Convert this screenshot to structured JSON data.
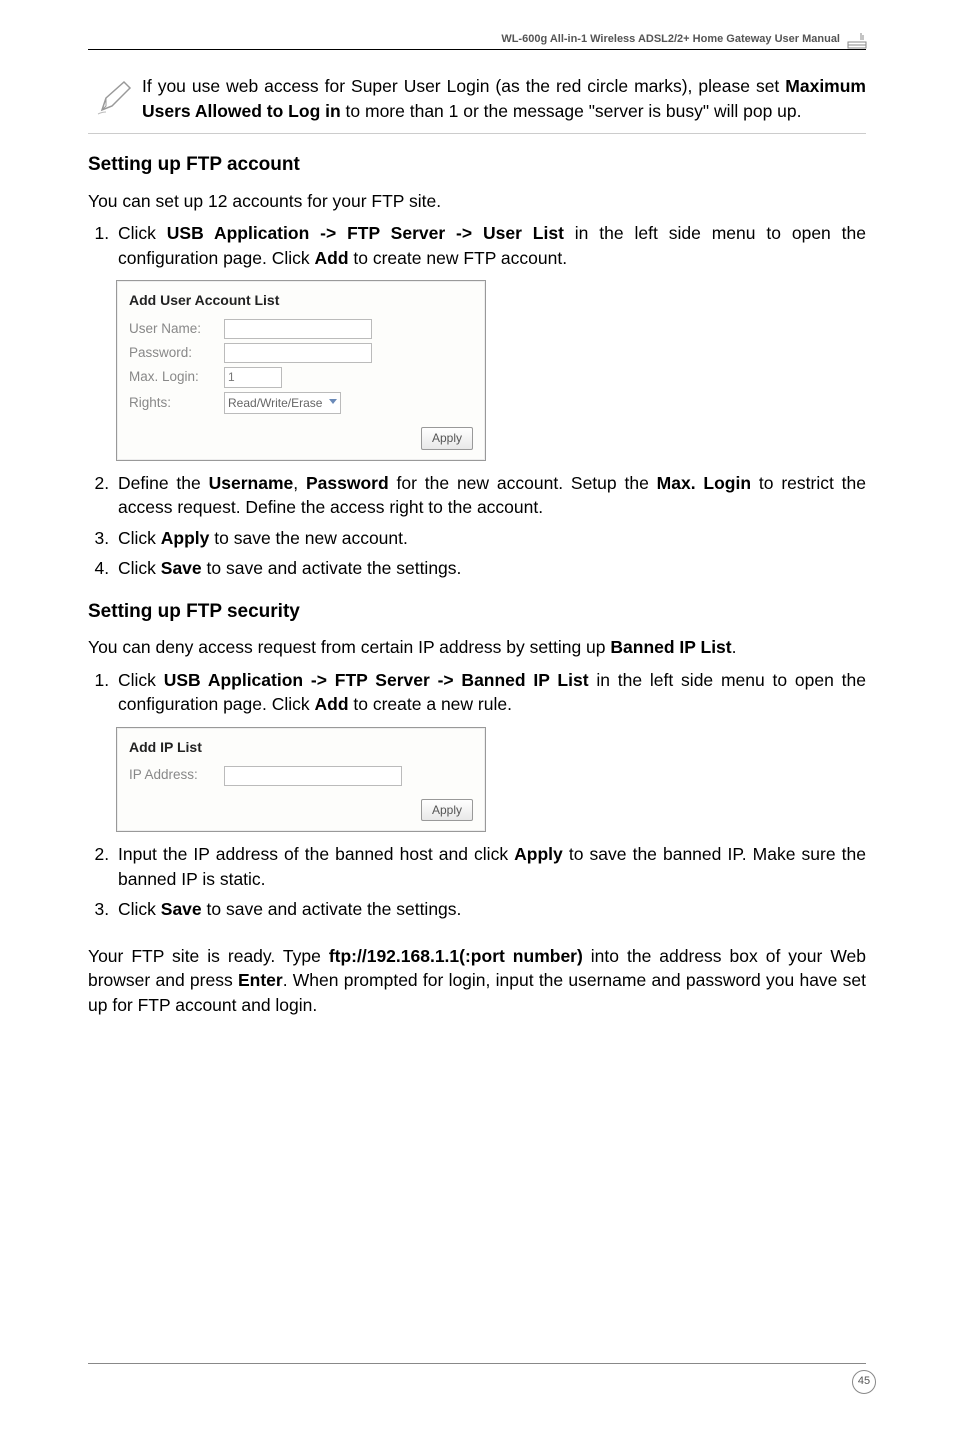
{
  "header": {
    "title": "WL-600g All-in-1 Wireless ADSL2/2+ Home Gateway User Manual"
  },
  "note": {
    "text_a": "If you use web access for Super User Login (as the red circle marks), please set ",
    "text_b": "Maximum Users Allowed to Log in",
    "text_c": " to more than 1 or the message \"server is busy\" will pop up."
  },
  "section1": {
    "heading": "Setting up FTP account",
    "intro": "You can set up 12 accounts for your FTP site.",
    "step1_a": "Click ",
    "step1_b": "USB Application -> FTP Server -> User List",
    "step1_c": " in the left side menu to open the configuration page. Click ",
    "step1_d": "Add",
    "step1_e": " to create new FTP account.",
    "panel": {
      "title": "Add User Account List",
      "user_label": "User Name:",
      "pass_label": "Password:",
      "max_label": "Max. Login:",
      "max_value": "1",
      "rights_label": "Rights:",
      "rights_value": "Read/Write/Erase",
      "apply": "Apply"
    },
    "step2_a": "Define the ",
    "step2_b": "Username",
    "step2_c": ", ",
    "step2_d": "Password",
    "step2_e": " for the new account. Setup the ",
    "step2_f": "Max. Login",
    "step2_g": " to restrict the access request. Define the access right to the account.",
    "step3_a": "Click ",
    "step3_b": "Apply",
    "step3_c": " to save the new account.",
    "step4_a": "Click ",
    "step4_b": "Save",
    "step4_c": " to save and activate the settings."
  },
  "section2": {
    "heading": "Setting up FTP security",
    "intro_a": "You can deny access request from certain IP address by setting up ",
    "intro_b": "Banned IP List",
    "intro_c": ".",
    "step1_a": "Click ",
    "step1_b": "USB Application -> FTP Server -> Banned IP List",
    "step1_c": " in the left side menu to open the configuration page. Click ",
    "step1_d": "Add",
    "step1_e": " to create a new rule.",
    "panel": {
      "title": "Add IP List",
      "ip_label": "IP Address:",
      "apply": "Apply"
    },
    "step2_a": "Input the IP address of the banned host and click ",
    "step2_b": "Apply",
    "step2_c": " to save the banned IP. Make sure the banned IP is static.",
    "step3_a": "Click ",
    "step3_b": "Save",
    "step3_c": " to save and activate the settings."
  },
  "footer_para": {
    "a": "Your FTP site is ready. Type ",
    "b": "ftp://192.168.1.1(:port number)",
    "c": " into the address box of your Web browser and press ",
    "d": "Enter",
    "e": ". When prompted for login, input the username and password you have set up for FTP account and login."
  },
  "page_number": "45"
}
